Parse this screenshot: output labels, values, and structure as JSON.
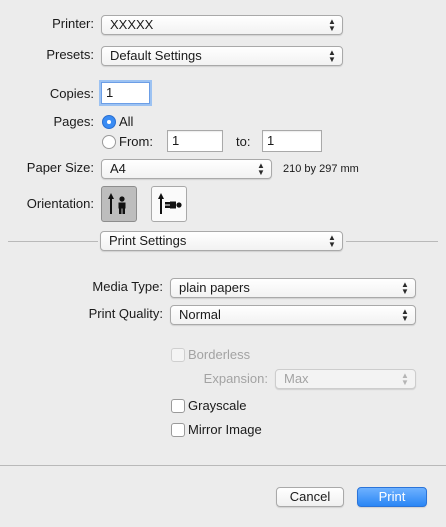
{
  "printer": {
    "label": "Printer:",
    "value": "XXXXX"
  },
  "presets": {
    "label": "Presets:",
    "value": "Default Settings"
  },
  "copies": {
    "label": "Copies:",
    "value": "1"
  },
  "pages": {
    "label": "Pages:",
    "all_label": "All",
    "from_label": "From:",
    "from_value": "1",
    "to_label": "to:",
    "to_value": "1"
  },
  "paper_size": {
    "label": "Paper Size:",
    "value": "A4",
    "dimensions": "210 by 297 mm"
  },
  "orientation": {
    "label": "Orientation:",
    "selected": "portrait"
  },
  "section": {
    "value": "Print Settings"
  },
  "media_type": {
    "label": "Media Type:",
    "value": "plain papers"
  },
  "print_quality": {
    "label": "Print Quality:",
    "value": "Normal"
  },
  "borderless": {
    "label": "Borderless",
    "checked": false,
    "enabled": false
  },
  "expansion": {
    "label": "Expansion:",
    "value": "Max",
    "enabled": false
  },
  "grayscale": {
    "label": "Grayscale",
    "checked": false
  },
  "mirror_image": {
    "label": "Mirror Image",
    "checked": false
  },
  "buttons": {
    "cancel": "Cancel",
    "print": "Print"
  },
  "colors": {
    "accent": "#3a8cf4",
    "primary_button": "#2a86f5",
    "background": "#ececec"
  }
}
